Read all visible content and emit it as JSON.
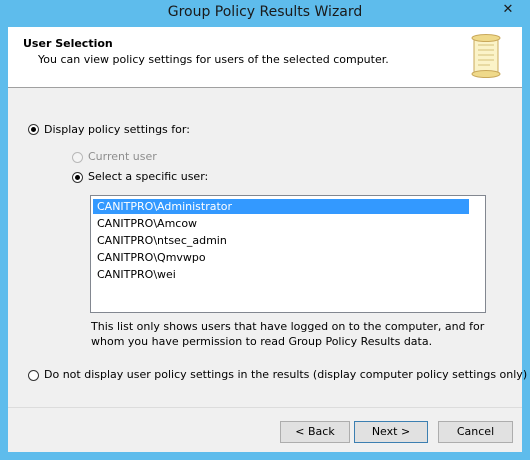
{
  "window": {
    "title": "Group Policy Results Wizard",
    "close_glyph": "✕"
  },
  "header": {
    "title": "User Selection",
    "subtitle": "You can view policy settings for users of the selected computer.",
    "icon": "scroll-icon"
  },
  "options": {
    "display_for_label": "Display policy settings for:",
    "current_user_label": "Current user",
    "specific_user_label": "Select a specific user:",
    "no_display_label": "Do not display user policy settings in the results (display computer policy settings only)"
  },
  "users": [
    "CANITPRO\\Administrator",
    "CANITPRO\\Amcow",
    "CANITPRO\\ntsec_admin",
    "CANITPRO\\Qmvwpo",
    "CANITPRO\\wei"
  ],
  "selected_user": "CANITPRO\\Administrator",
  "note": "This list only shows users that have logged on to the computer, and for whom you have permission to read Group Policy Results data.",
  "buttons": {
    "back": "< Back",
    "next": "Next >",
    "cancel": "Cancel"
  },
  "colors": {
    "titlebar": "#5ebcec",
    "selection": "#3399ff",
    "dialog": "#f0f0f0"
  }
}
